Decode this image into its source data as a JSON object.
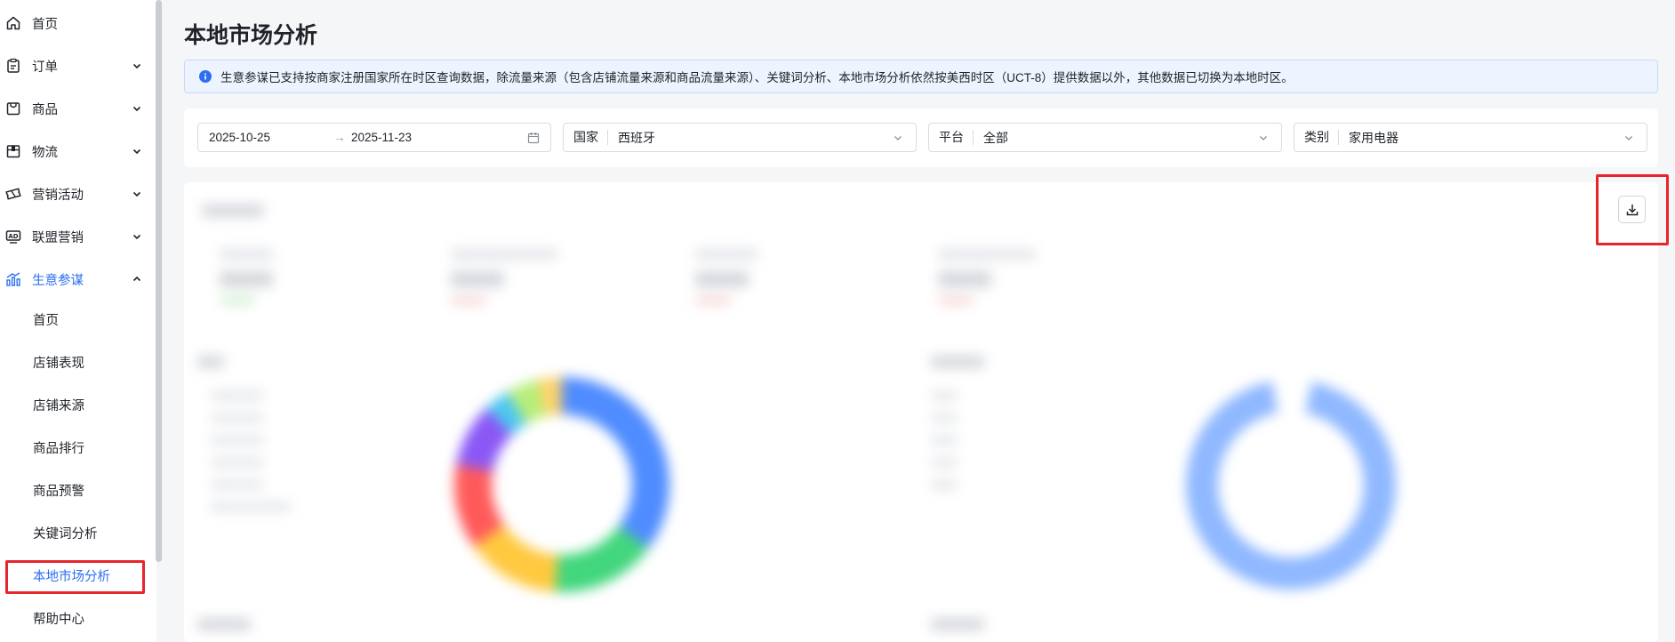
{
  "sidebar": {
    "items": [
      {
        "label": "首页",
        "icon": "home-icon",
        "expandable": false
      },
      {
        "label": "订单",
        "icon": "order-icon",
        "expandable": true
      },
      {
        "label": "商品",
        "icon": "product-bag-icon",
        "expandable": true
      },
      {
        "label": "物流",
        "icon": "logistics-box-icon",
        "expandable": true
      },
      {
        "label": "营销活动",
        "icon": "ticket-icon",
        "expandable": true
      },
      {
        "label": "联盟营销",
        "icon": "ad-icon",
        "expandable": true
      },
      {
        "label": "生意参谋",
        "icon": "bar-chart-icon",
        "expandable": true,
        "expanded": true
      }
    ],
    "sub_items": [
      "首页",
      "店铺表现",
      "店铺来源",
      "商品排行",
      "商品预警",
      "关键词分析",
      "本地市场分析",
      "帮助中心"
    ],
    "current_sub_item": "本地市场分析"
  },
  "page": {
    "title": "本地市场分析",
    "notice": "生意参谋已支持按商家注册国家所在时区查询数据，除流量来源（包含店铺流量来源和商品流量来源）、关键词分析、本地市场分析依然按美西时区（UCT-8）提供数据以外，其他数据已切换为本地时区。"
  },
  "filters": {
    "date_start": "2025-10-25",
    "date_separator": "→",
    "date_end": "2025-11-23",
    "country_label": "国家",
    "country_value": "西班牙",
    "platform_label": "平台",
    "platform_value": "全部",
    "category_label": "类别",
    "category_value": "家用电器"
  },
  "colors": {
    "accent": "#2e6ff2",
    "highlight_box": "#e8242c",
    "notice_bg": "#eef4ff"
  },
  "toolbar": {
    "download_icon": "download-icon"
  }
}
